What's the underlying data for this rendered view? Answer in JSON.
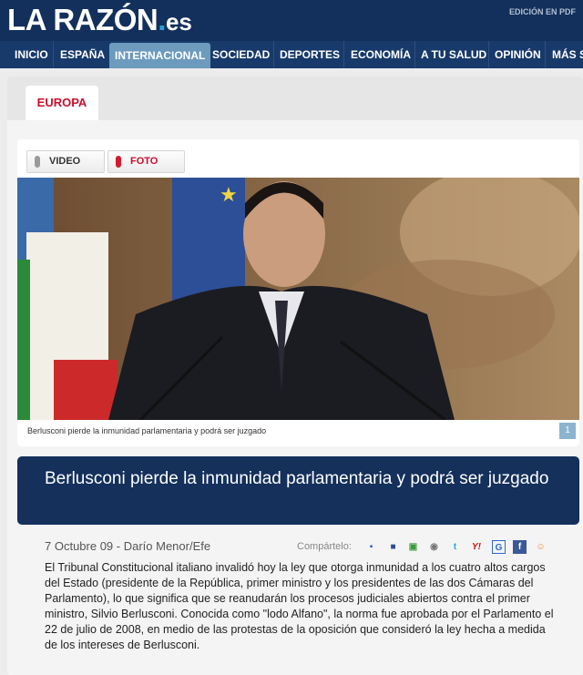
{
  "header": {
    "logo_main": "LA RAZÓN",
    "logo_dot": ".",
    "logo_tld": "es",
    "edition_link": "EDICIÓN EN PDF"
  },
  "nav": {
    "items": [
      "INICIO",
      "ESPAÑA",
      "INTERNACIONAL",
      "SOCIEDAD",
      "DEPORTES",
      "ECONOMÍA",
      "A TU SALUD",
      "OPINIÓN",
      "MÁS S"
    ],
    "active": "INTERNACIONAL"
  },
  "section": {
    "label": "EUROPA"
  },
  "media": {
    "video_label": "VIDEO",
    "photo_label": "FOTO",
    "caption": "Berlusconi pierde la inmunidad parlamentaria y podrá ser juzgado",
    "page_number": "1"
  },
  "article": {
    "headline": "Berlusconi pierde la inmunidad parlamentaria y podrá ser juzgado",
    "byline": "7 Octubre 09 - Darío Menor/Efe",
    "share_label": "Compártelo:",
    "body": "El Tribunal Constitucional italiano invalidó hoy la ley que otorga inmunidad a los cuatro altos cargos del Estado  (presidente de la República, primer ministro y los presidentes de las dos Cámaras del Parlamento), lo que significa que se reanudarán los procesos judiciales abiertos contra el primer ministro, Silvio Berlusconi. Conocida como \"lodo Alfano\", la norma fue aprobada por el Parlamento el 22 de julio de 2008, en medio de las protestas de la oposición que consideró la ley hecha a medida de los intereses de Berlusconi."
  },
  "share_icons": [
    {
      "name": "delicious-icon",
      "glyph": "▪",
      "color": "#1f5ebd"
    },
    {
      "name": "menéame-icon",
      "glyph": "■",
      "color": "#2b4f8e"
    },
    {
      "name": "technorati-icon",
      "glyph": "▣",
      "color": "#3d9b3d"
    },
    {
      "name": "digg-icon",
      "glyph": "◉",
      "color": "#777777"
    },
    {
      "name": "twitter-icon",
      "glyph": "t",
      "color": "#2fa6d9"
    },
    {
      "name": "yahoo-icon",
      "glyph": "Y!",
      "color": "#cc1111"
    },
    {
      "name": "google-icon",
      "glyph": "G",
      "color": "#3366cc"
    },
    {
      "name": "facebook-icon",
      "glyph": "f",
      "color": "#3b5998"
    },
    {
      "name": "blogger-icon",
      "glyph": "☺",
      "color": "#f08a24"
    }
  ],
  "colors": {
    "masthead": "#13305c",
    "accent_red": "#c8102e",
    "headline_bg": "#14305b",
    "nav_active": "#6c9bbd"
  }
}
